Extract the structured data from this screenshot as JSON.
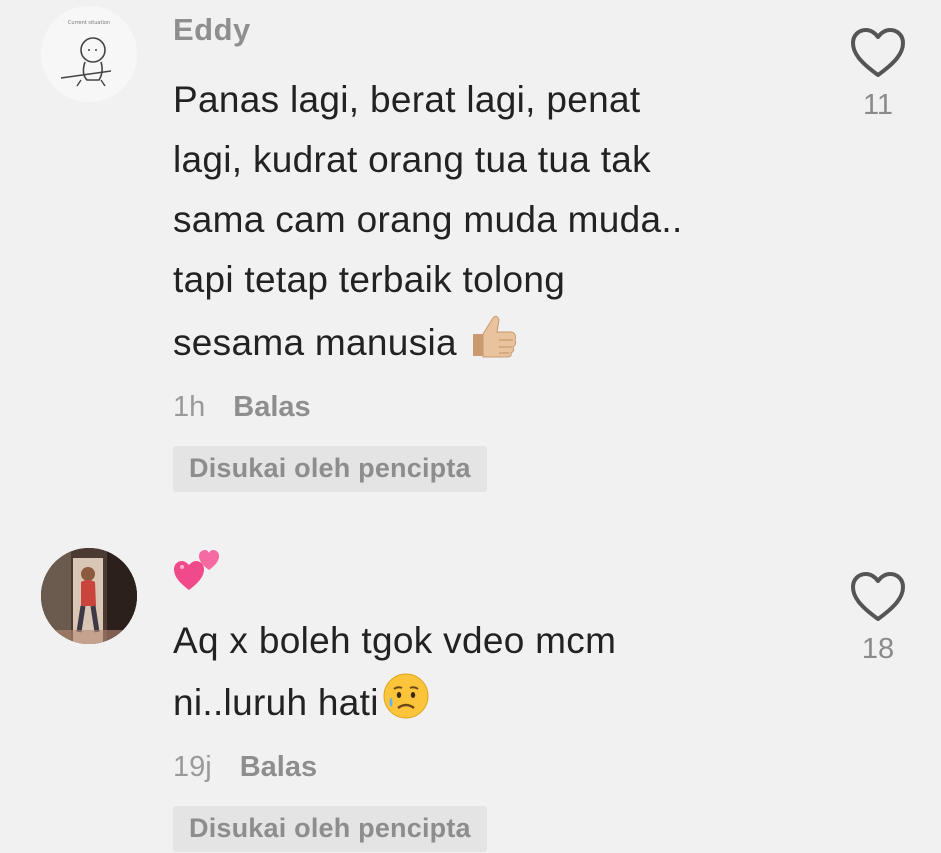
{
  "comments": [
    {
      "username": "Eddy",
      "avatar_text": "Current situation",
      "text_lines": [
        "Panas lagi, berat lagi, penat",
        "lagi, kudrat orang tua tua tak",
        "sama cam orang muda muda..",
        "tapi tetap terbaik tolong",
        "sesama manusia"
      ],
      "emoji": "thumbs-up-icon",
      "time": "1h",
      "reply_label": "Balas",
      "liked_by_creator_label": "Disukai oleh pencipta",
      "like_count": "11"
    },
    {
      "username": "",
      "username_emoji": "two-hearts-icon",
      "text_lines": [
        "Aq x boleh tgok vdeo mcm",
        "ni..luruh hati"
      ],
      "emoji": "sad-but-relieved-face-icon",
      "time": "19j",
      "reply_label": "Balas",
      "liked_by_creator_label": "Disukai oleh pencipta",
      "like_count": "18"
    }
  ],
  "colors": {
    "background": "#f1f1f1",
    "username": "#8f8f8f",
    "text": "#222222",
    "meta": "#9a9a9a",
    "badge_bg": "#e4e4e4",
    "heart": "#555555"
  }
}
